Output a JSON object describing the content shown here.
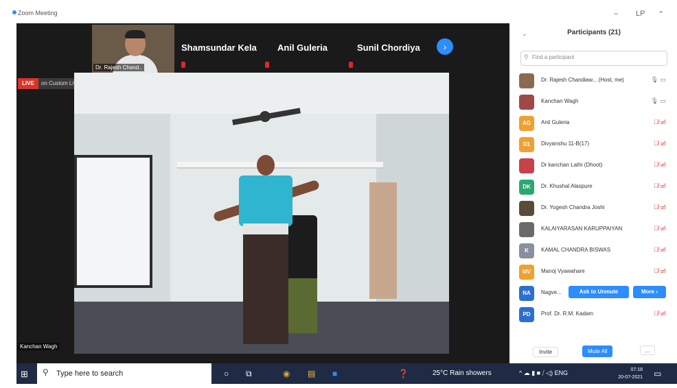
{
  "window": {
    "title": "Zoom Meeting",
    "controls": [
      "–",
      "LP",
      "⌃"
    ]
  },
  "gallery": {
    "thumb_name": "Dr. Rajesh Chand..",
    "names": [
      "Shamsundar Kela",
      "Anil Guleria",
      "Sunil Chordiya"
    ],
    "next_glyph": "›"
  },
  "live": {
    "badge": "LIVE",
    "text": "on Custom Live Streaming Service ▾"
  },
  "video": {
    "speaker_label": "Kanchan Wagh"
  },
  "participants": {
    "title": "Participants (21)",
    "search_placeholder": "Find a participant",
    "rows": [
      {
        "name": "Dr. Rajesh Chandiaw...  (Host, me)",
        "initials": "",
        "color": "#8a6a55",
        "icons": "🎙 ▭"
      },
      {
        "name": "Kanchan Wagh",
        "initials": "",
        "color": "#a04848",
        "icons": "🎙 ▭"
      },
      {
        "name": "Anil Guleria",
        "initials": "AG",
        "color": "#f0a030",
        "icons": "🎙̸ ▭̸"
      },
      {
        "name": "Divyanshu 11-B(17)",
        "initials": "D1",
        "color": "#f0a030",
        "icons": "🎙̸ ▭̸"
      },
      {
        "name": "Dr kanchan Lathi (Dhoot)",
        "initials": "",
        "color": "#c8404a",
        "icons": "🎙̸ ▭̸"
      },
      {
        "name": "Dr. Khushal Alaspure",
        "initials": "DK",
        "color": "#2aa870",
        "icons": "🎙̸ ▭̸"
      },
      {
        "name": "Dr. Yogesh Chandra Joshi",
        "initials": "",
        "color": "#5a4a3a",
        "icons": "🎙̸ ▭̸"
      },
      {
        "name": "KALAIYARASAN KARUPPAIYAN",
        "initials": "",
        "color": "#6a6a6a",
        "icons": "🎙̸ ▭̸"
      },
      {
        "name": "KAMAL CHANDRA BISWAS",
        "initials": "K",
        "color": "#8a8fa0",
        "icons": "🎙̸ ▭̸"
      },
      {
        "name": "Manoj Vyawahare",
        "initials": "MV",
        "color": "#f0a030",
        "icons": "🎙̸ ▭̸"
      },
      {
        "name": "Nagve...",
        "initials": "NA",
        "color": "#2d6fd0",
        "icons": ""
      },
      {
        "name": "Prof. Dr. R.M. Kadam",
        "initials": "PD",
        "color": "#2d6fd0",
        "icons": "🎙̸ ▭̸"
      }
    ],
    "ask_to_unmute": "Ask to Unmute",
    "more": "More ›",
    "invite": "Invite",
    "mute_all": "Mute All",
    "more_dots": "..."
  },
  "taskbar": {
    "search_placeholder": "Type here to search",
    "weather": "25°C  Rain showers",
    "tray": "^ ☁ ▮ ■ ⧸ ◁) ENG",
    "time": "07:18",
    "date": "20-07-2021"
  }
}
